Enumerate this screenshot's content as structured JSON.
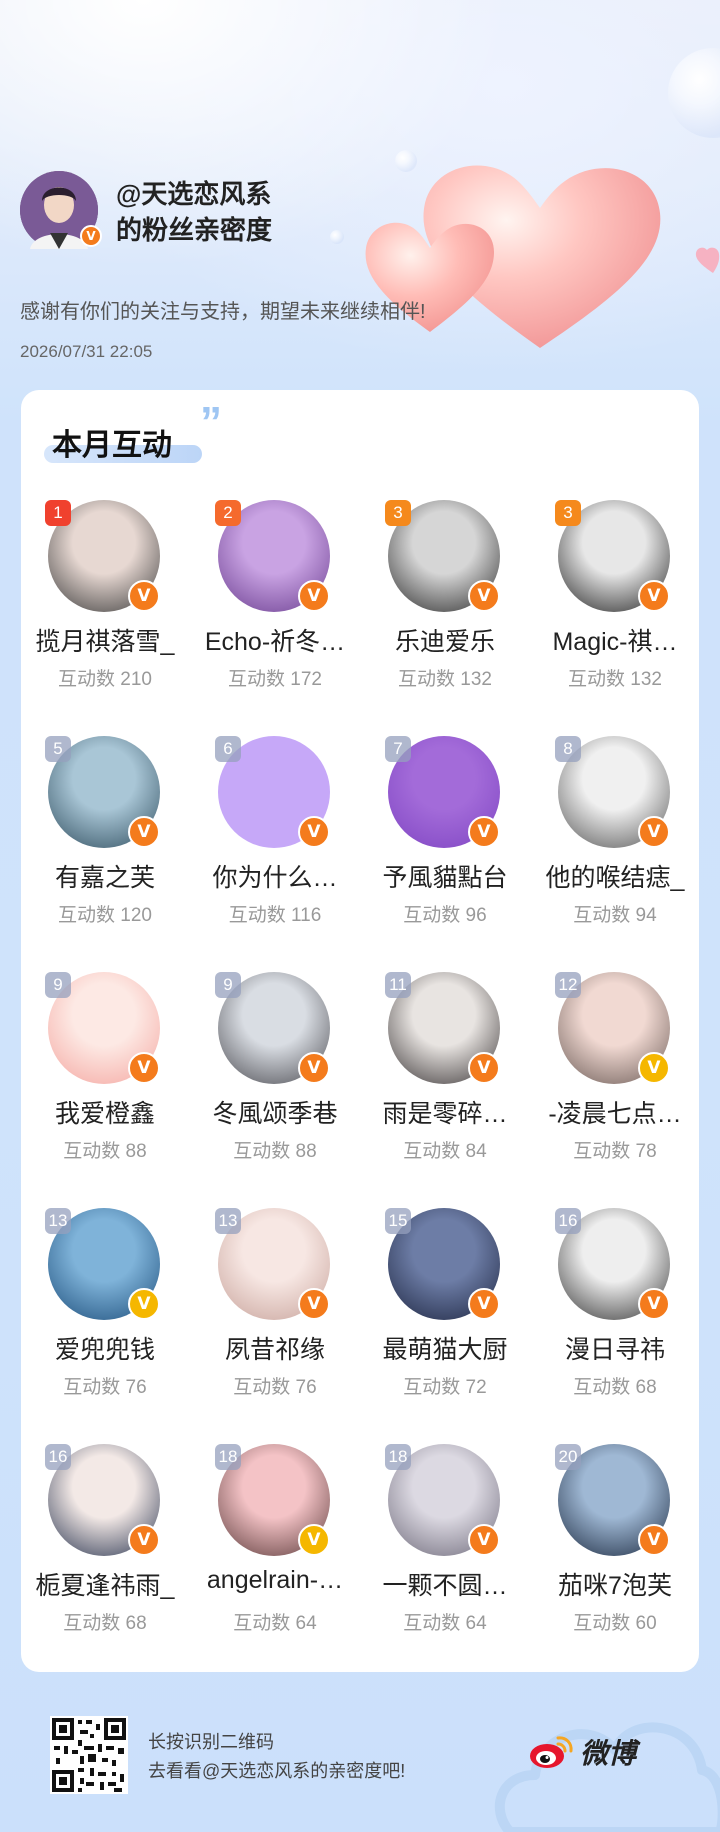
{
  "header": {
    "title_line1": "@天选恋风系",
    "title_line2": "的粉丝亲密度",
    "subtitle": "感谢有你们的关注与支持，期望未来继续相伴!",
    "timestamp": "2026/07/31  22:05",
    "avatar_icon": "user-avatar",
    "badge_icon": "verified-v-badge",
    "badge_text": "V"
  },
  "section": {
    "title": "本月互动",
    "quote": "”"
  },
  "fans": [
    {
      "rank": "1",
      "name": "揽月祺落雪_",
      "count": "互动数 210",
      "badge": "orange",
      "color_a": "#e7d8d2",
      "color_b": "#3a3a3a"
    },
    {
      "rank": "2",
      "name": "Echo-祈冬…",
      "count": "互动数 172",
      "badge": "orange",
      "color_a": "#c9a3e3",
      "color_b": "#6a3d8f"
    },
    {
      "rank": "3",
      "name": "乐迪爱乐",
      "count": "互动数 132",
      "badge": "orange",
      "color_a": "#d6d6d6",
      "color_b": "#2a2a2a"
    },
    {
      "rank": "3",
      "name": "Magic-祺…",
      "count": "互动数 132",
      "badge": "orange",
      "color_a": "#e7e7e7",
      "color_b": "#222222"
    },
    {
      "rank": "5",
      "name": "有嘉之芙",
      "count": "互动数 120",
      "badge": "orange",
      "color_a": "#a9c6d6",
      "color_b": "#2f4d5e"
    },
    {
      "rank": "6",
      "name": "你为什么…",
      "count": "互动数 116",
      "badge": "orange",
      "color_a": "#c6a8f8",
      "color_b": "#c6a8f8"
    },
    {
      "rank": "7",
      "name": "予風貓點台",
      "count": "互动数 96",
      "badge": "orange",
      "color_a": "#a36bd9",
      "color_b": "#7f45c2"
    },
    {
      "rank": "8",
      "name": "他的喉结痣_",
      "count": "互动数 94",
      "badge": "orange",
      "color_a": "#f0f0f0",
      "color_b": "#555555"
    },
    {
      "rank": "9",
      "name": "我爱橙鑫",
      "count": "互动数 88",
      "badge": "orange",
      "color_a": "#fde9e4",
      "color_b": "#f4a6a0"
    },
    {
      "rank": "9",
      "name": "冬風颂季巷",
      "count": "互动数 88",
      "badge": "orange",
      "color_a": "#d9dde3",
      "color_b": "#4a4a50"
    },
    {
      "rank": "11",
      "name": "雨是零碎…",
      "count": "互动数 84",
      "badge": "orange",
      "color_a": "#e8e4e1",
      "color_b": "#3a3536"
    },
    {
      "rank": "12",
      "name": "-凌晨七点…",
      "count": "互动数 78",
      "badge": "yellow",
      "color_a": "#f1d9d2",
      "color_b": "#6a5a55"
    },
    {
      "rank": "13",
      "name": "爱兜兜钱",
      "count": "互动数 76",
      "badge": "yellow",
      "color_a": "#7fb3d9",
      "color_b": "#1c4d7a"
    },
    {
      "rank": "13",
      "name": "夙昔祁缘",
      "count": "互动数 76",
      "badge": "orange",
      "color_a": "#f7e7e3",
      "color_b": "#c7a29a"
    },
    {
      "rank": "15",
      "name": "最萌猫大厨",
      "count": "互动数 72",
      "badge": "orange",
      "color_a": "#6d7da6",
      "color_b": "#1d2540"
    },
    {
      "rank": "16",
      "name": "漫日寻祎",
      "count": "互动数 68",
      "badge": "orange",
      "color_a": "#eeeeee",
      "color_b": "#333333"
    },
    {
      "rank": "16",
      "name": "栀夏逢祎雨_",
      "count": "互动数 68",
      "badge": "orange",
      "color_a": "#f3e9e6",
      "color_b": "#2a3550"
    },
    {
      "rank": "18",
      "name": "angelrain-…",
      "count": "互动数 64",
      "badge": "yellow",
      "color_a": "#f4c3c6",
      "color_b": "#5b3a3a"
    },
    {
      "rank": "18",
      "name": "一颗不圆…",
      "count": "互动数 64",
      "badge": "orange",
      "color_a": "#dcd9e2",
      "color_b": "#6e6a7a"
    },
    {
      "rank": "20",
      "name": "茄咪7泡芙",
      "count": "互动数 60",
      "badge": "orange",
      "color_a": "#9fb8d4",
      "color_b": "#1c2a40"
    }
  ],
  "footer": {
    "line1": "长按识别二维码",
    "line2": "去看看@天选恋风系的亲密度吧!",
    "brand": "微博",
    "qr_icon": "qr-code-icon",
    "logo_icon": "weibo-logo-icon"
  }
}
